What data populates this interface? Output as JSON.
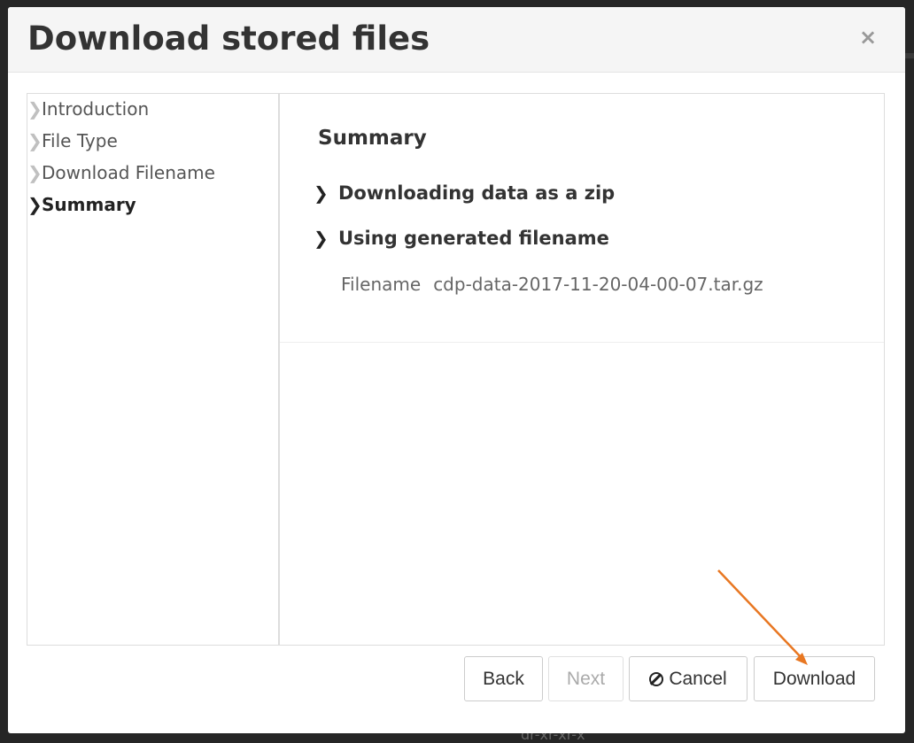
{
  "background": {
    "text": "dr-xr-xr-x"
  },
  "dialog": {
    "title": "Download stored files",
    "close_glyph": "×"
  },
  "steps": [
    {
      "label": "Introduction",
      "active": false
    },
    {
      "label": "File Type",
      "active": false
    },
    {
      "label": "Download Filename",
      "active": false
    },
    {
      "label": "Summary",
      "active": true
    }
  ],
  "summary": {
    "title": "Summary",
    "items": [
      "Downloading data as a zip",
      "Using generated filename"
    ],
    "filename_label": "Filename",
    "filename_value": "cdp-data-2017-11-20-04-00-07.tar.gz"
  },
  "buttons": {
    "back": "Back",
    "next": "Next",
    "cancel": "Cancel",
    "download": "Download"
  },
  "icons": {
    "step_chevron": "chevron-right-icon",
    "cancel": "ban-icon",
    "close": "close-icon"
  },
  "colors": {
    "arrow": "#e87722",
    "header_bg": "#f5f5f5"
  }
}
